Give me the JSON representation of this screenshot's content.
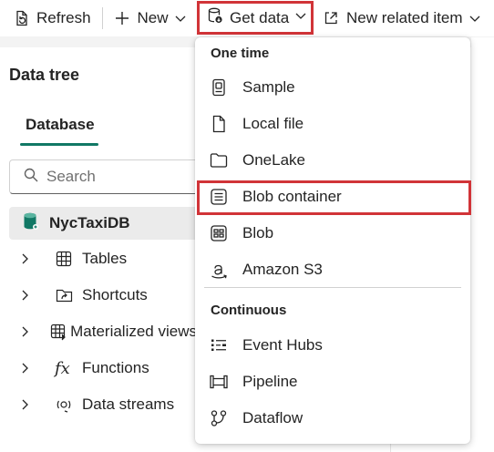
{
  "toolbar": {
    "refresh_label": "Refresh",
    "new_label": "New",
    "get_data_label": "Get data",
    "new_related_label": "New related item"
  },
  "panel": {
    "title": "Data tree",
    "tab_label": "Database",
    "search_placeholder": "Search",
    "database_name": "NycTaxiDB",
    "tree_items": [
      {
        "label": "Tables",
        "icon": "table-icon"
      },
      {
        "label": "Shortcuts",
        "icon": "shortcut-icon"
      },
      {
        "label": "Materialized views",
        "icon": "materialized-view-icon"
      },
      {
        "label": "Functions",
        "icon": "function-icon"
      },
      {
        "label": "Data streams",
        "icon": "data-stream-icon"
      }
    ]
  },
  "dropdown": {
    "section_one_time": "One time",
    "section_continuous": "Continuous",
    "one_time_items": [
      {
        "label": "Sample",
        "icon": "sample-icon"
      },
      {
        "label": "Local file",
        "icon": "file-icon"
      },
      {
        "label": "OneLake",
        "icon": "folder-icon"
      },
      {
        "label": "Blob container",
        "icon": "blob-container-icon"
      },
      {
        "label": "Blob",
        "icon": "blob-icon"
      },
      {
        "label": "Amazon S3",
        "icon": "amazon-icon"
      }
    ],
    "continuous_items": [
      {
        "label": "Event Hubs",
        "icon": "event-hubs-icon"
      },
      {
        "label": "Pipeline",
        "icon": "pipeline-icon"
      },
      {
        "label": "Dataflow",
        "icon": "dataflow-icon"
      }
    ]
  },
  "colors": {
    "highlight": "#d13438",
    "accent": "#117865",
    "db_icon": "#117865"
  }
}
